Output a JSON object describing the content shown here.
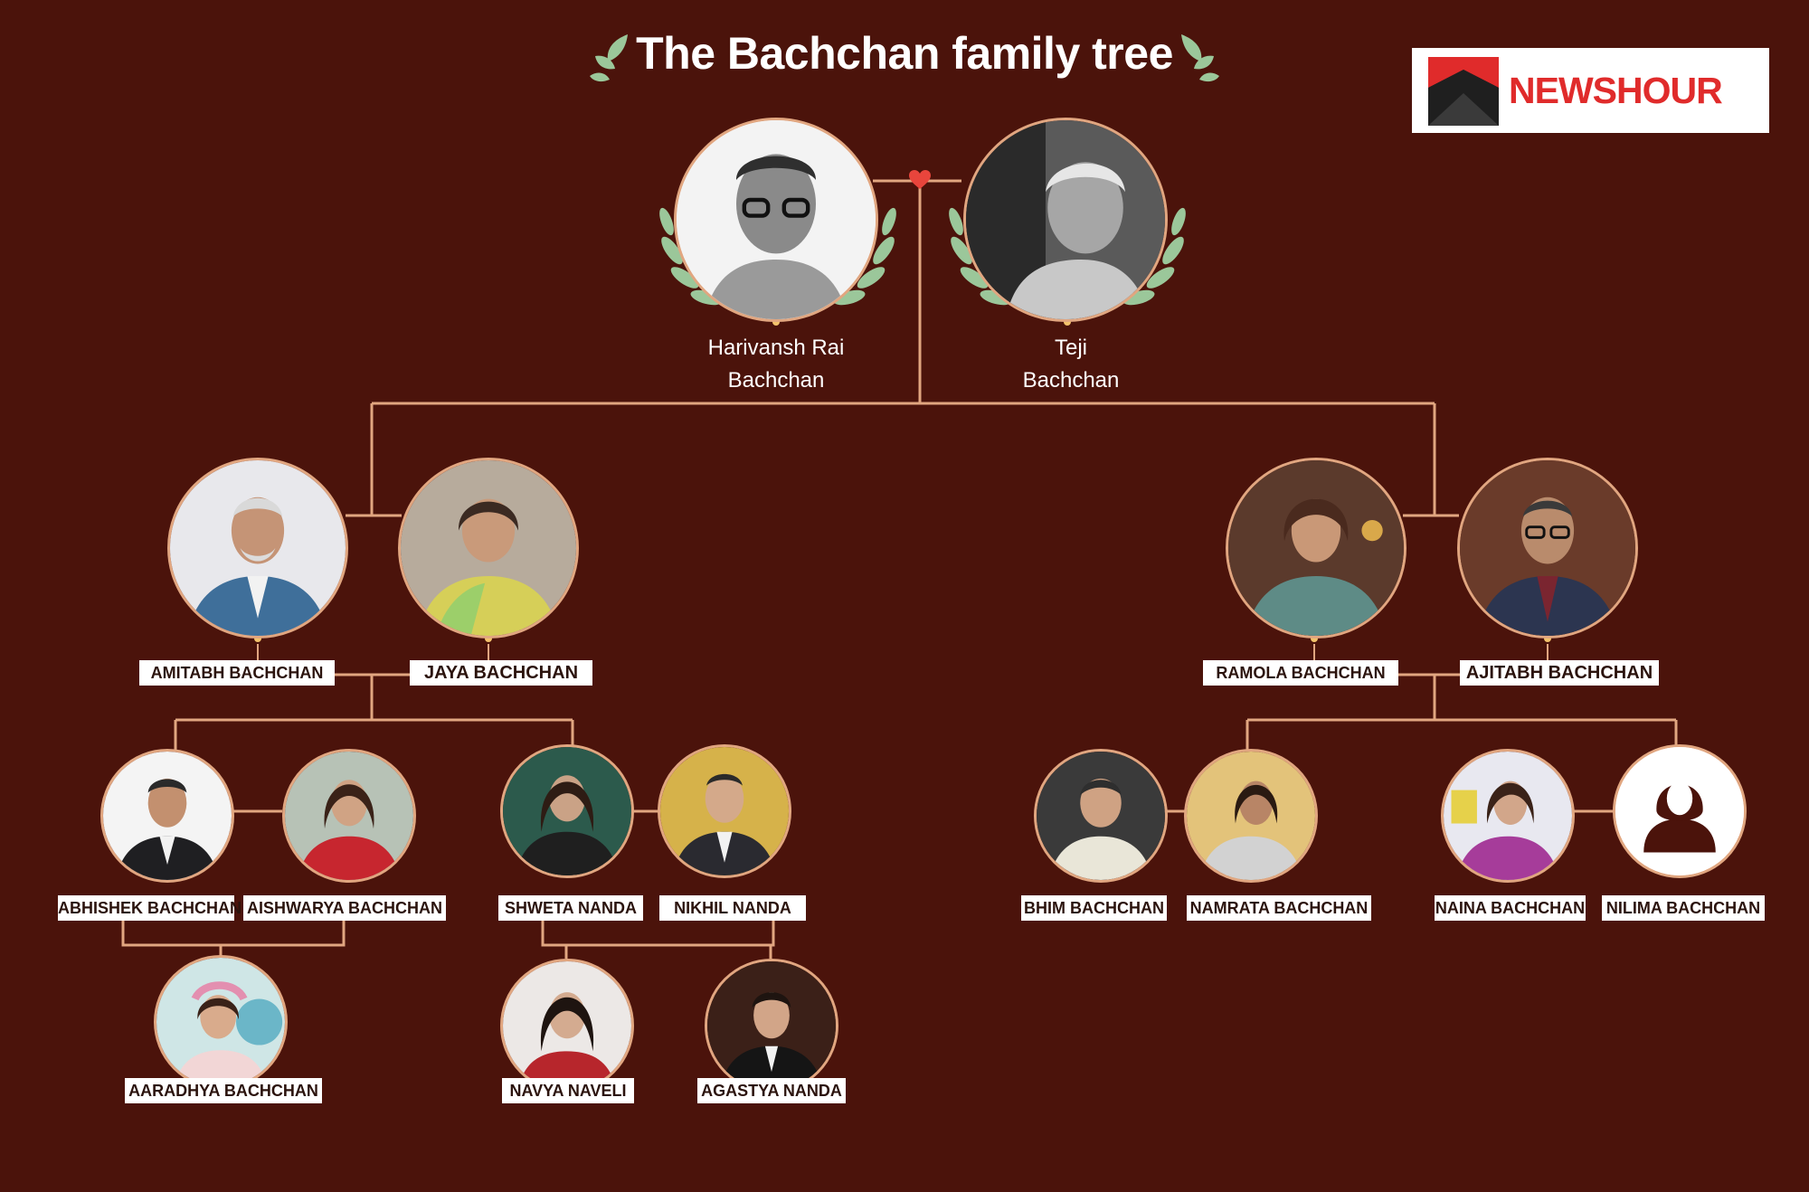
{
  "title": "The Bachchan family tree",
  "brand": {
    "name": "NEWSHOUR",
    "color": "#e02b2b"
  },
  "colors": {
    "background": "#4b130b",
    "connector": "#e1a680",
    "laurel": "#9bc79a",
    "heart": "#e8453c",
    "label_bg": "#ffffff",
    "label_text": "#2b130d"
  },
  "grandparents": {
    "left": {
      "line1": "Harivansh Rai",
      "line2": "Bachchan",
      "icon": "portrait-icon"
    },
    "right": {
      "line1": "Teji",
      "line2": "Bachchan",
      "icon": "portrait-icon"
    }
  },
  "people": {
    "amitabh": "AMITABH BACHCHAN",
    "jaya": "JAYA BACHCHAN",
    "ramola": "RAMOLA  BACHCHAN",
    "ajitabh": "AJITABH BACHCHAN",
    "abhishek": "ABHISHEK BACHCHAN",
    "aishwarya": "AISHWARYA BACHCHAN",
    "shweta": "SHWETA NANDA",
    "nikhil": "NIKHIL NANDA",
    "bhim": "BHIM BACHCHAN",
    "namrata": "NAMRATA BACHCHAN",
    "naina": "NAINA BACHCHAN",
    "nilima": "NILIMA  BACHCHAN",
    "aaradhya": "AARADHYA BACHCHAN",
    "navya": "NAVYA NAVELI",
    "agastya": "AGASTYA NANDA"
  },
  "placeholder_icon": "person-silhouette-icon"
}
